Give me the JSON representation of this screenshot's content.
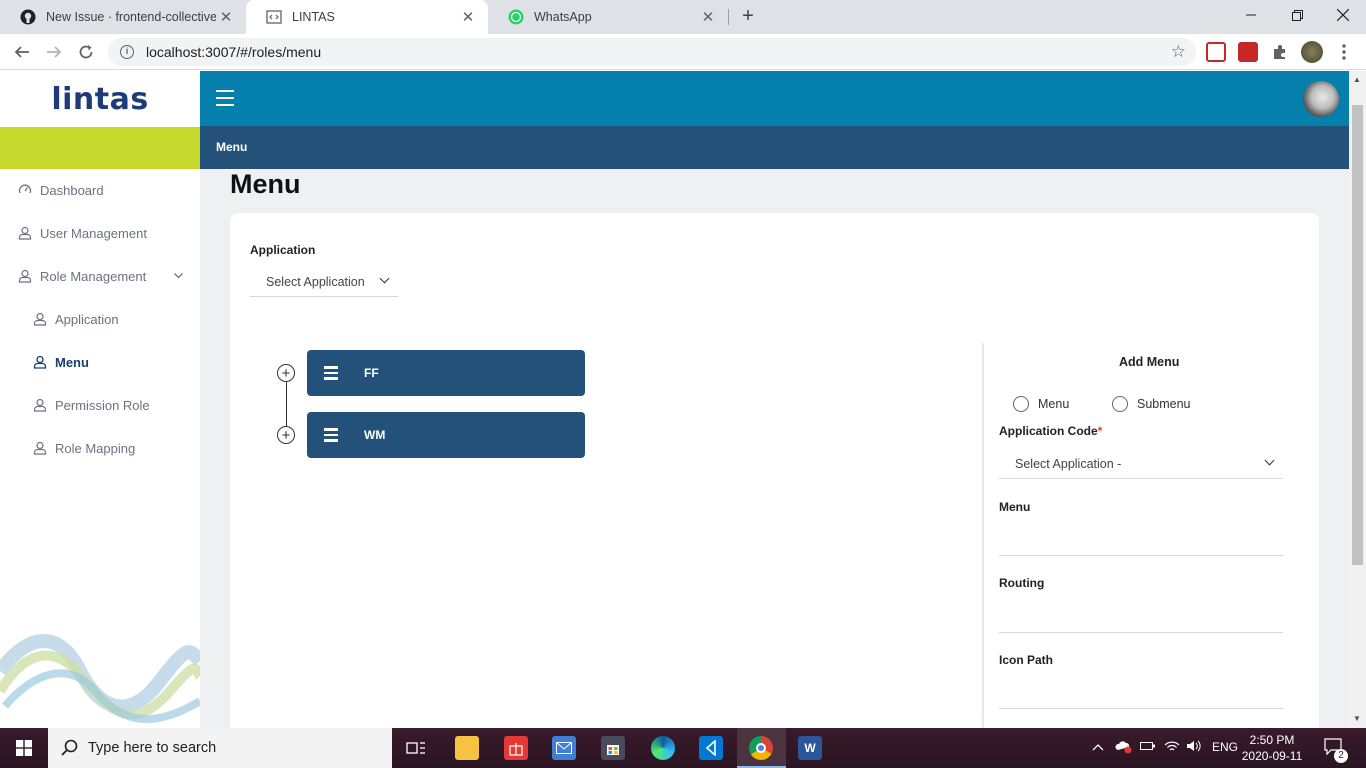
{
  "browser": {
    "tabs": [
      {
        "title": "New Issue · frontend-collective/r",
        "active": false
      },
      {
        "title": "LINTAS",
        "active": true
      },
      {
        "title": "WhatsApp",
        "active": false
      }
    ],
    "new_tab": "+",
    "url": "localhost:3007/#/roles/menu"
  },
  "app": {
    "logo": "lintas",
    "breadcrumb": "Menu",
    "sidebar": {
      "dashboard": "Dashboard",
      "user_management": "User Management",
      "role_management": "Role Management",
      "application": "Application",
      "menu": "Menu",
      "permission_role": "Permission Role",
      "role_mapping": "Role Mapping"
    },
    "page_title": "Menu",
    "application_label": "Application",
    "application_select": "Select Application",
    "tree": [
      {
        "label": "FF"
      },
      {
        "label": "WM"
      }
    ],
    "form": {
      "title": "Add Menu",
      "radio_menu": "Menu",
      "radio_submenu": "Submenu",
      "app_code_label": "Application Code",
      "required_mark": "*",
      "app_code_select": "Select Application -",
      "menu_label": "Menu",
      "routing_label": "Routing",
      "icon_path_label": "Icon Path"
    }
  },
  "taskbar": {
    "search_placeholder": "Type here to search",
    "lang": "ENG",
    "time": "2:50 PM",
    "date": "2020-09-11",
    "notifications": "2"
  },
  "colors": {
    "header": "#0580ac",
    "breadcrumb_bar": "#245179",
    "lime": "#c5d92d",
    "node": "#245179"
  }
}
